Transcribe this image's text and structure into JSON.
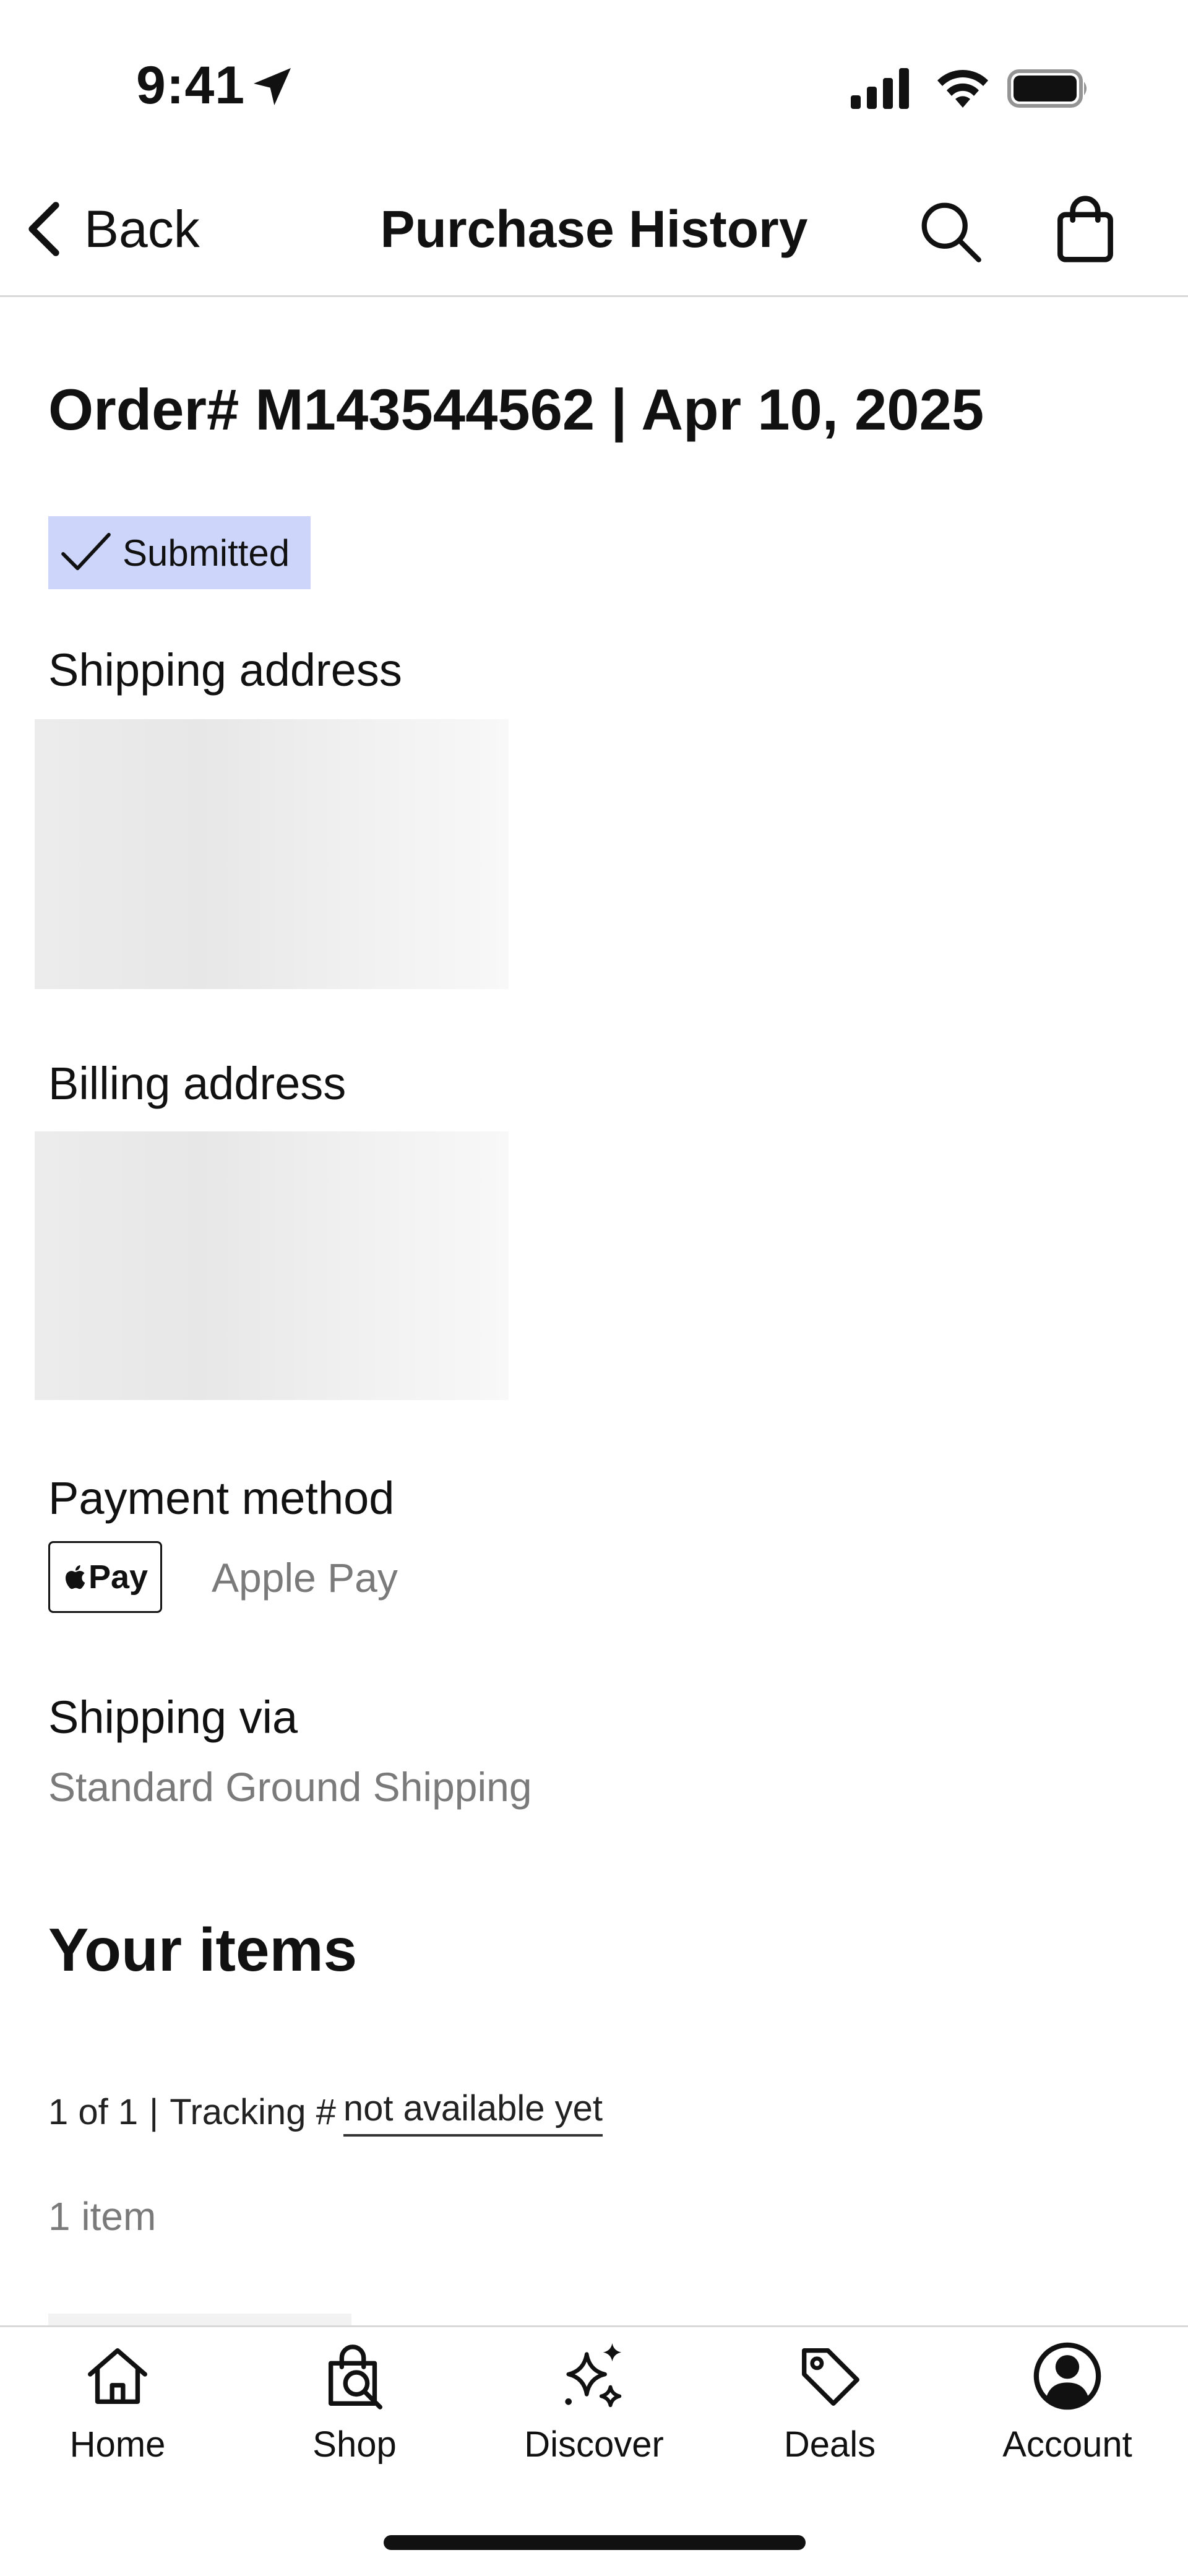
{
  "status_bar": {
    "time": "9:41"
  },
  "nav": {
    "back_label": "Back",
    "title": "Purchase History"
  },
  "order": {
    "header": "Order# M143544562 | Apr 10, 2025",
    "status": "Submitted",
    "status_color": "#cdd5fb"
  },
  "shipping_address": {
    "label": "Shipping address"
  },
  "billing_address": {
    "label": "Billing address"
  },
  "payment": {
    "label": "Payment method",
    "badge": "Pay",
    "method": "Apple Pay"
  },
  "shipping_via": {
    "label": "Shipping via",
    "value": "Standard Ground Shipping"
  },
  "items": {
    "heading": "Your items",
    "shipment_index": "1 of 1",
    "separator": "|",
    "tracking_label": "Tracking #",
    "tracking_value": "not available yet",
    "count": "1 item"
  },
  "tabbar": {
    "tabs": [
      {
        "label": "Home",
        "icon": "home-icon"
      },
      {
        "label": "Shop",
        "icon": "shop-icon"
      },
      {
        "label": "Discover",
        "icon": "sparkle-icon"
      },
      {
        "label": "Deals",
        "icon": "tag-icon"
      },
      {
        "label": "Account",
        "icon": "account-icon"
      }
    ]
  }
}
